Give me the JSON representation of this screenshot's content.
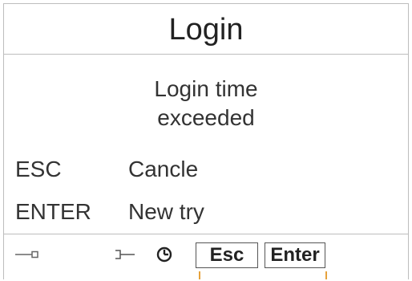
{
  "header": {
    "title": "Login"
  },
  "message": {
    "line1": "Login time",
    "line2": "exceeded"
  },
  "options": [
    {
      "key": "ESC",
      "action": "Cancle"
    },
    {
      "key": "ENTER",
      "action": "New try"
    }
  ],
  "statusbar": {
    "icons": [
      "connection-plug-icon",
      "connection-socket-icon",
      "clock-icon"
    ]
  },
  "softkeys": {
    "esc_label": "Esc",
    "enter_label": "Enter"
  },
  "colors": {
    "border": "#bdbdbd",
    "accent_tick": "#e6a23c"
  }
}
